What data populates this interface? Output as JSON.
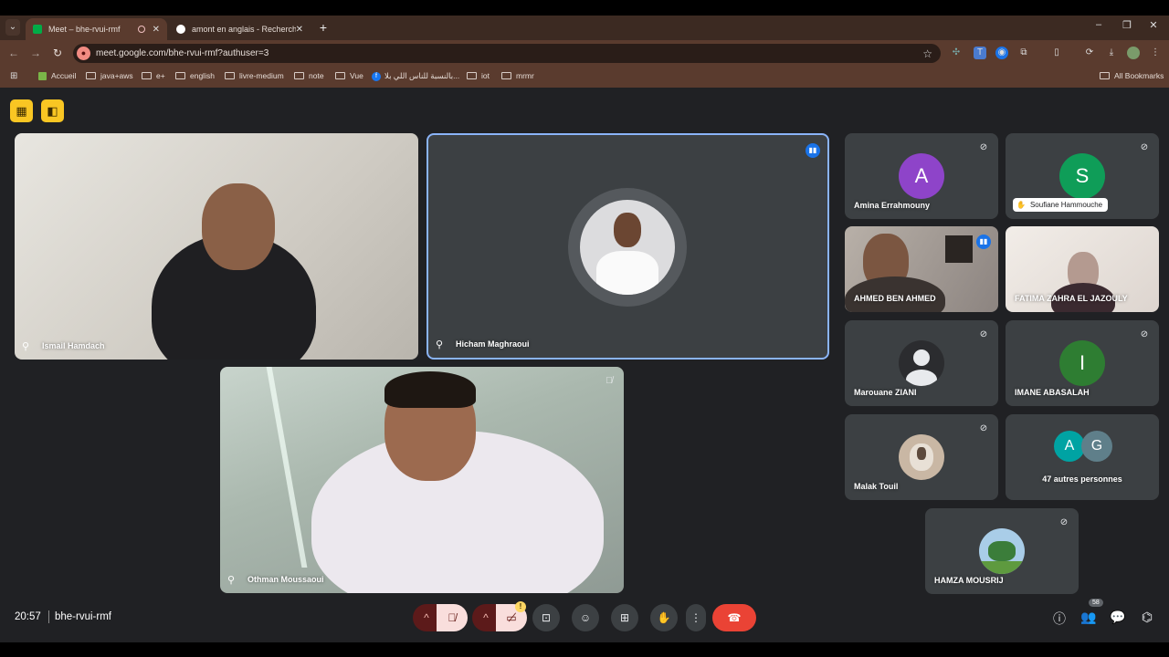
{
  "browser": {
    "tabs": [
      {
        "title": "Meet – bhe-rvui-rmf",
        "active": true
      },
      {
        "title": "amont en anglais - Recherche G",
        "active": false
      }
    ],
    "url": "meet.google.com/bhe-rvui-rmf?authuser=3",
    "bookmarks": [
      "Accueil",
      "java+aws",
      "e+",
      "english",
      "livre-medium",
      "note",
      "Vue",
      "بالنسبة للناس اللي بلا...",
      "iot",
      "mrmr"
    ],
    "all_bookmarks": "All Bookmarks"
  },
  "meet": {
    "main_tiles": [
      {
        "name": "Ismail Hamdach"
      },
      {
        "name": "Hicham Maghraoui"
      },
      {
        "name": "Othman Moussaoui"
      }
    ],
    "side_tiles": [
      {
        "name": "Amina Errahmouny",
        "initial": "A",
        "color": "#8e44c9"
      },
      {
        "name": "Soufiane Hammouche",
        "initial": "S",
        "color": "#0f9d58"
      },
      {
        "name": "AHMED BEN AHMED"
      },
      {
        "name": "FATIMA ZAHRA EL JAZOULY"
      },
      {
        "name": "Marouane ZIANI"
      },
      {
        "name": "IMANE ABASALAH",
        "initial": "I",
        "color": "#2e7d32"
      },
      {
        "name": "Malak Touil"
      },
      {
        "name": "47 autres personnes",
        "initials": [
          "A",
          "G"
        ],
        "colors": [
          "#00a3a3",
          "#5f7f8a"
        ]
      },
      {
        "name": "HAMZA MOUSRIJ"
      }
    ],
    "clock": "20:57",
    "meeting_code": "bhe-rvui-rmf",
    "participant_count": "58"
  }
}
